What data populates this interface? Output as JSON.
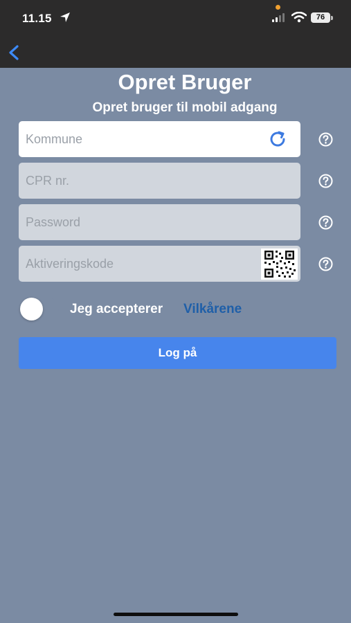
{
  "status_bar": {
    "time": "11.15",
    "battery": "76"
  },
  "header": {
    "title": "Opret Bruger",
    "subtitle": "Opret bruger til mobil adgang"
  },
  "form": {
    "municipality": {
      "placeholder": "Kommune",
      "value": ""
    },
    "cpr": {
      "placeholder": "CPR nr.",
      "value": ""
    },
    "password": {
      "placeholder": "Password",
      "value": ""
    },
    "activation_code": {
      "placeholder": "Aktiveringskode",
      "value": ""
    }
  },
  "terms": {
    "accept_label": "Jeg accepterer",
    "link_label": "Vilkårene",
    "accepted": false
  },
  "login_button": {
    "label": "Log på"
  },
  "colors": {
    "background": "#7b8ba3",
    "status_bar": "#2c2b2b",
    "accent": "#4785ec",
    "link": "#1f5fa8",
    "field": "#d1d6dd"
  },
  "icons": [
    "location-arrow-icon",
    "signal-icon",
    "wifi-icon",
    "back-icon",
    "refresh-icon",
    "qr-code-icon",
    "help-icon"
  ]
}
